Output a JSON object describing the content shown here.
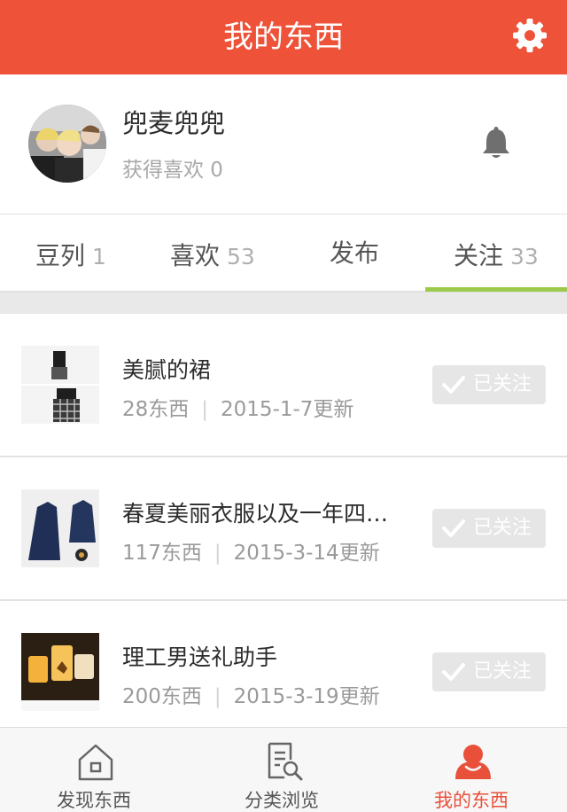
{
  "header": {
    "title": "我的东西",
    "settings_icon": "gear-icon"
  },
  "profile": {
    "name": "兜麦兜兜",
    "likes_label": "获得喜欢 0",
    "notification_icon": "bell-icon"
  },
  "tabs": [
    {
      "label": "豆列",
      "count": "1"
    },
    {
      "label": "喜欢",
      "count": "53"
    },
    {
      "label": "发布",
      "count": ""
    },
    {
      "label": "关注",
      "count": "33",
      "active": true
    }
  ],
  "list": [
    {
      "name": "美腻的裙",
      "count": "28东西",
      "updated": "2015-1-7更新",
      "button": "已关注"
    },
    {
      "name": "春夏美丽衣服以及一年四…",
      "count": "117东西",
      "updated": "2015-3-14更新",
      "button": "已关注"
    },
    {
      "name": "理工男送礼助手",
      "count": "200东西",
      "updated": "2015-3-19更新",
      "button": "已关注"
    }
  ],
  "bottom_nav": [
    {
      "label": "发现东西",
      "icon": "home-icon"
    },
    {
      "label": "分类浏览",
      "icon": "browse-icon"
    },
    {
      "label": "我的东西",
      "icon": "user-icon",
      "active": true
    }
  ],
  "colors": {
    "accent": "#ee533a",
    "tab_indicator": "#9cc94a",
    "active_nav": "#e9503a"
  }
}
